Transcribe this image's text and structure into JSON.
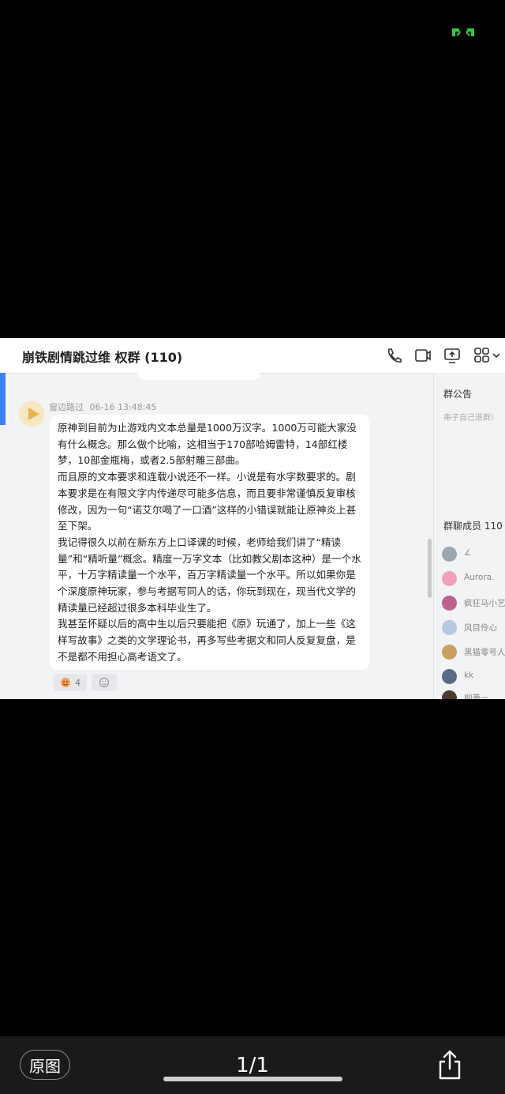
{
  "status_bar": {
    "icon": "expand-arrows-icon",
    "accent": "#2ecc40"
  },
  "chat": {
    "title": "崩铁剧情跳过维 权群 (110)",
    "header_icons": [
      "phone-icon",
      "video-icon",
      "screen-share-icon",
      "apps-icon",
      "chevron-down-icon"
    ],
    "message": {
      "sender": "窗边路过",
      "time": "06-16 13:48:45",
      "paragraphs": [
        "原神到目前为止游戏内文本总量是1000万汉字。1000万可能大家没有什么概念。那么做个比喻，这相当于170部哈姆雷特，14部红楼梦，10部金瓶梅，或者2.5部射雕三部曲。",
        "而且原的文本要求和连载小说还不一样。小说是有水字数要求的。剧本要求是在有限文字内传递尽可能多信息，而且要非常谨慎反复审核修改，因为一句“诺艾尔喝了一口酒”这样的小错误就能让原神炎上甚至下架。",
        "我记得很久以前在新东方上口译课的时候，老师给我们讲了“精读量”和“精听量”概念。精度一万字文本（比如教父剧本这种）是一个水平，十万字精读量一个水平，百万字精读量一个水平。所以如果你是个深度原神玩家，参与考据写同人的话，你玩到现在，现当代文学的精读量已经超过很多本科毕业生了。",
        "我甚至怀疑以后的高中生以后只要能把《原》玩通了，加上一些《这样写故事》之类的文学理论书，再多写些考据文和同人反复复盘，是不是都不用担心高考语文了。"
      ],
      "reaction_count": "4"
    }
  },
  "side": {
    "notice_title": "群公告",
    "notice_text": "串子自己退群）",
    "members_title": "群聊成员 110",
    "members": [
      {
        "name": "∠",
        "color": "#9aa6b2"
      },
      {
        "name": "Aurora.",
        "color": "#f0a0b8"
      },
      {
        "name": "疯狂马小艺",
        "color": "#c06090"
      },
      {
        "name": "风目伶心",
        "color": "#b8c8e0"
      },
      {
        "name": "黑猫零号人",
        "color": "#c8a060"
      },
      {
        "name": "kk",
        "color": "#5a6a88"
      },
      {
        "name": "柳萧一",
        "color": "#4a3a32"
      }
    ]
  },
  "viewer": {
    "original_label": "原图",
    "counter": "1/1"
  }
}
